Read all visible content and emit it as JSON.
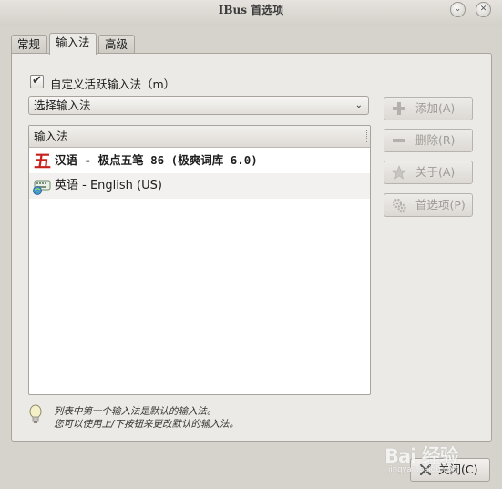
{
  "window": {
    "title": "IBus 首选项",
    "minimize_glyph": "⌄",
    "close_glyph": "✕"
  },
  "tabs": [
    {
      "label": "常规",
      "active": false
    },
    {
      "label": "输入法",
      "active": true
    },
    {
      "label": "高级",
      "active": false
    }
  ],
  "customize": {
    "label": "自定义活跃输入法（m）",
    "checked": true,
    "check_glyph": "✔"
  },
  "select": {
    "value": "选择输入法",
    "arrow_glyph": "⌄"
  },
  "list": {
    "header": "输入法",
    "rows": [
      {
        "label": "汉语 - 极点五笔 86 (极爽词库 6.0)",
        "icon": "wubi-icon",
        "icon_glyph": "五"
      },
      {
        "label": "英语 - English (US)",
        "icon": "keyboard-icon"
      }
    ]
  },
  "buttons": {
    "add": "添加(A)",
    "remove": "删除(R)",
    "about": "关于(A)",
    "prefs": "首选项(P)",
    "close": "关闭(C)"
  },
  "hint": {
    "line1": "列表中第一个输入法是默认的输入法。",
    "line2": "您可以使用上/下按钮来更改默认的输入法。"
  },
  "watermark": {
    "brand": "Bai 经验",
    "domain": "jingyan.baidu.com"
  },
  "colors": {
    "wubi_icon_red": "#c8221c",
    "disabled_text": "#9e9b96"
  }
}
